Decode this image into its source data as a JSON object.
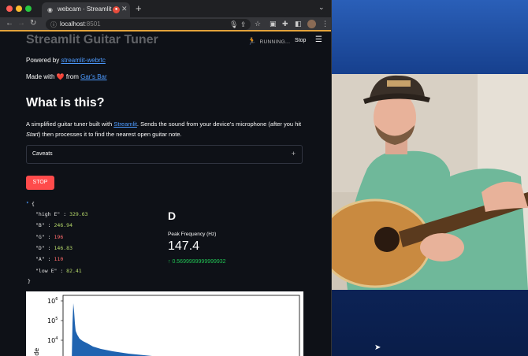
{
  "browser": {
    "tab_title": "webcam · Streamlit",
    "new_tab": "+",
    "url_host": "localhost",
    "url_port": ":8501"
  },
  "app": {
    "header_title": "Streamlit Guitar Tuner",
    "running_label": "RUNNING...",
    "stop_link": "Stop",
    "powered_prefix": "Powered by ",
    "powered_link": "streamlit-webrtc",
    "made_prefix": "Made with ",
    "made_heart": "❤️",
    "made_middle": " from ",
    "made_link": "Gar's Bar",
    "heading": "What is this?",
    "desc_before": "A simplified guitar tuner built with ",
    "desc_link": "Streamlit",
    "desc_mid": ". Sends the sound from your device's microphone (after you hit ",
    "desc_start": "Start",
    "desc_end": ") then processes it to find the nearest open guitar note.",
    "caveats_label": "Caveats",
    "stop_button": "STOP",
    "json": [
      {
        "key": "\"high E\"",
        "value": "329.63",
        "style": "num"
      },
      {
        "key": "\"B\"",
        "value": "246.94",
        "style": "num"
      },
      {
        "key": "\"G\"",
        "value": "196",
        "style": "red"
      },
      {
        "key": "\"D\"",
        "value": "146.83",
        "style": "num"
      },
      {
        "key": "\"A\"",
        "value": "110",
        "style": "red"
      },
      {
        "key": "\"low E\"",
        "value": "82.41",
        "style": "num"
      }
    ],
    "note": "D",
    "metric_label": "Peak Frequency (Hz)",
    "metric_value": "147.4",
    "metric_delta": "0.5699999999999932",
    "plot_ticks": [
      "10",
      "10",
      "10"
    ],
    "plot_exps": [
      "6",
      "5",
      "4"
    ],
    "plot_ylabel": "tude"
  },
  "colors": {
    "accent": "#ff4b4b",
    "link": "#4d9bff",
    "delta": "#21c354",
    "loading_bar": "#e3a33b"
  }
}
